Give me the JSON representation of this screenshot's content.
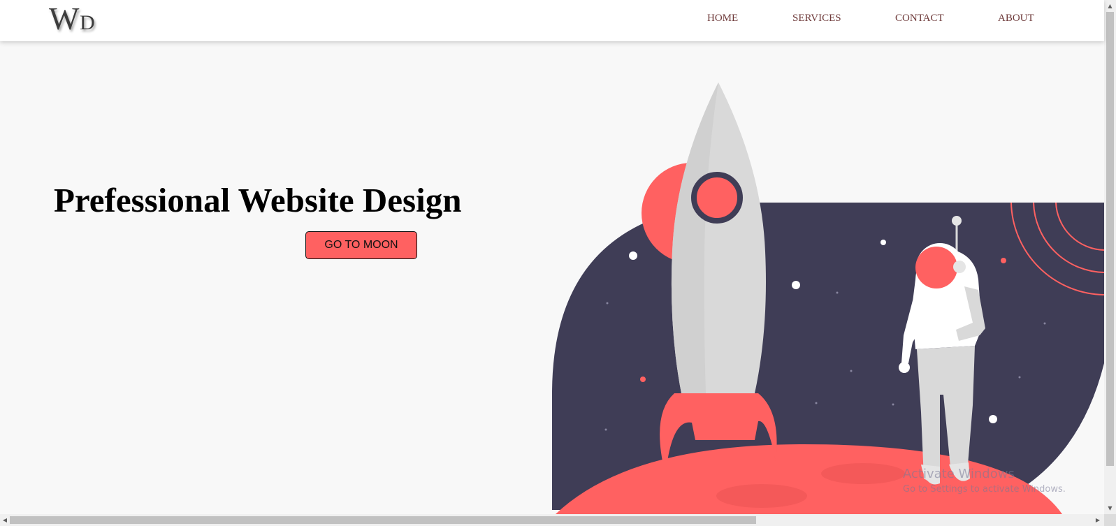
{
  "logo": {
    "letter1": "W",
    "letter2": "D"
  },
  "nav": {
    "home": "HOME",
    "services": "SERVICES",
    "contact": "CONTACT",
    "about": "ABOUT"
  },
  "hero": {
    "title": "Prefessional Website Design",
    "button_label": "GO TO MOON"
  },
  "watermark": {
    "title": "Activate Windows",
    "subtitle": "Go to Settings to activate Windows."
  },
  "colors": {
    "accent": "#ff6161",
    "dark": "#3f3d56",
    "rocket": "#d7d7d7",
    "background": "#f8f8f8",
    "nav_text": "#6e3a3a"
  },
  "icons": {
    "scroll_up": "triangle-up",
    "scroll_down": "triangle-down",
    "scroll_left": "triangle-left",
    "scroll_right": "triangle-right"
  }
}
